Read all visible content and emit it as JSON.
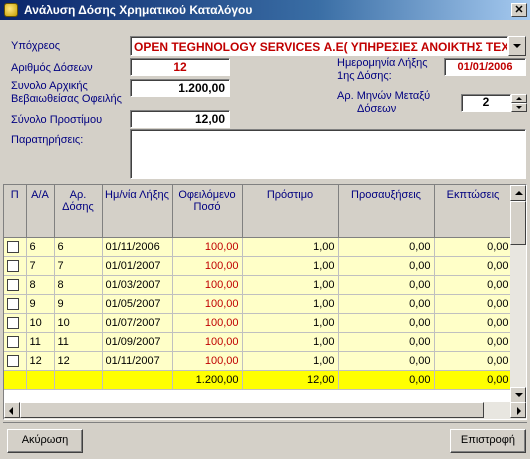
{
  "window": {
    "title": "Ανάλυση Δόσης Χρηματικού Καταλόγου",
    "close_glyph": "✕"
  },
  "form": {
    "debtor_label": "Υπόχρεος",
    "debtor_value": "OPEN TEGHNOLOGY SERVICES Α.Ε( ΥΠΗΡΕΣΙΕΣ ΑΝΟΙΚΤΗΣ ΤΕΧ",
    "installments_label": "Αριθμός Δόσεων",
    "installments_value": "12",
    "initial_debt_label_1": "Συνολο Αρχικής",
    "initial_debt_label_2": "Βεβαιωθείσας Οφειλής",
    "initial_debt_value": "1.200,00",
    "fine_total_label": "Σύνολο Προστίμου",
    "fine_total_value": "12,00",
    "first_due_label_1": "Ημερομηνία Λήξης",
    "first_due_label_2": "1ης Δόσης:",
    "first_due_value": "01/01/2006",
    "months_between_label_1": "Αρ. Μηνών Μεταξύ",
    "months_between_label_2": "Δόσεων",
    "months_between_value": "2",
    "notes_label": "Παρατηρήσεις:"
  },
  "grid": {
    "headers": {
      "p": "Π",
      "aa": "Α/Α",
      "dose_no": "Αρ. Δόσης",
      "due_date": "Ημ/νία Λήξης",
      "owed": "Οφειλόμενο Ποσό",
      "fine": "Πρόστιμο",
      "surcharges": "Προσαυξήσεις",
      "discounts": "Εκπτώσεις"
    },
    "rows": [
      {
        "aa": "6",
        "dose": "6",
        "date": "01/11/2006",
        "owed": "100,00",
        "fine": "1,00",
        "surcharges": "0,00",
        "discounts": "0,00"
      },
      {
        "aa": "7",
        "dose": "7",
        "date": "01/01/2007",
        "owed": "100,00",
        "fine": "1,00",
        "surcharges": "0,00",
        "discounts": "0,00"
      },
      {
        "aa": "8",
        "dose": "8",
        "date": "01/03/2007",
        "owed": "100,00",
        "fine": "1,00",
        "surcharges": "0,00",
        "discounts": "0,00"
      },
      {
        "aa": "9",
        "dose": "9",
        "date": "01/05/2007",
        "owed": "100,00",
        "fine": "1,00",
        "surcharges": "0,00",
        "discounts": "0,00"
      },
      {
        "aa": "10",
        "dose": "10",
        "date": "01/07/2007",
        "owed": "100,00",
        "fine": "1,00",
        "surcharges": "0,00",
        "discounts": "0,00"
      },
      {
        "aa": "11",
        "dose": "11",
        "date": "01/09/2007",
        "owed": "100,00",
        "fine": "1,00",
        "surcharges": "0,00",
        "discounts": "0,00"
      },
      {
        "aa": "12",
        "dose": "12",
        "date": "01/11/2007",
        "owed": "100,00",
        "fine": "1,00",
        "surcharges": "0,00",
        "discounts": "0,00"
      }
    ],
    "totals": {
      "owed": "1.200,00",
      "fine": "12,00",
      "surcharges": "0,00",
      "discounts": "0,00"
    }
  },
  "footer": {
    "cancel_label": "Ακύρωση",
    "back_label": "Επιστροφή"
  },
  "colors": {
    "title_bar": "#0a246a",
    "label_text": "#000080",
    "value_red": "#c00000",
    "row_highlight": "#ffffc8",
    "totals_row": "#ffff00"
  }
}
